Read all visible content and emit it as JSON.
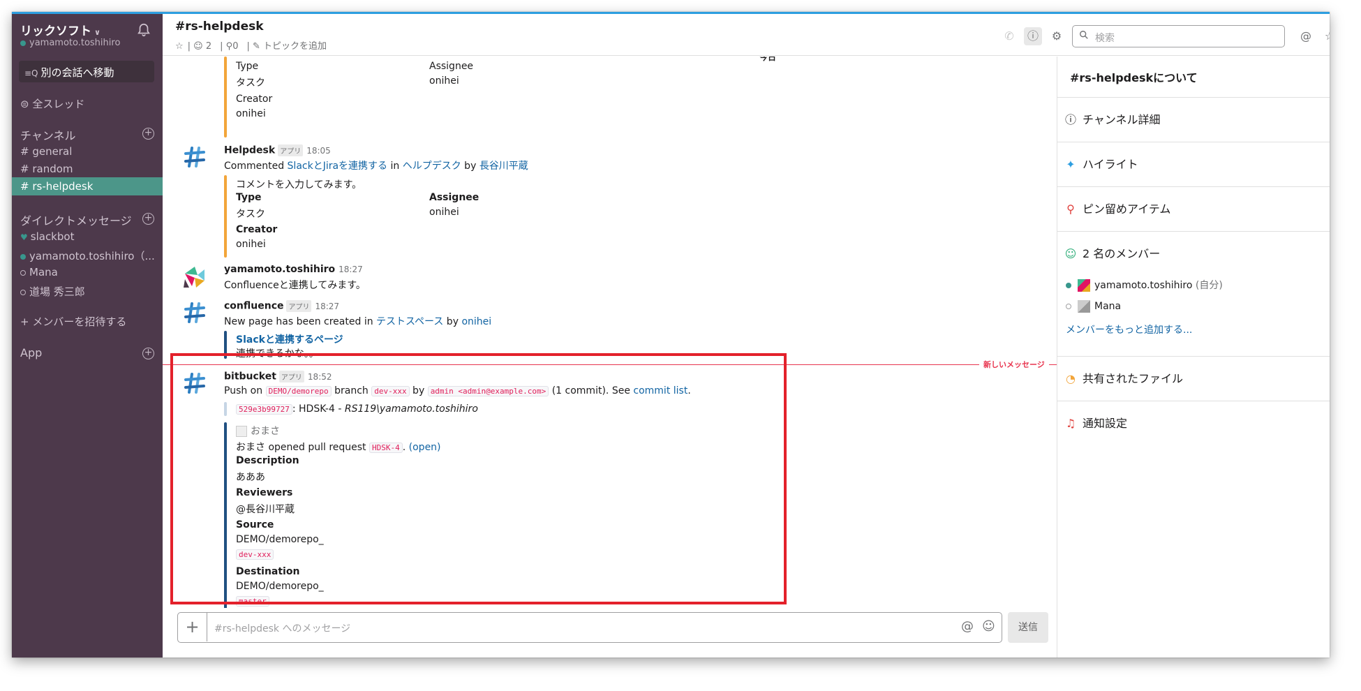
{
  "sidebar": {
    "team_name": "リックソフト",
    "user": "yamamoto.toshihiro",
    "jump_label": "別の会話へ移動",
    "threads_label": "全スレッド",
    "channels_header": "チャンネル",
    "channels": [
      "general",
      "random",
      "rs-helpdesk"
    ],
    "active_channel": "rs-helpdesk",
    "dm_header": "ダイレクトメッセージ",
    "dms": [
      "slackbot",
      "yamamoto.toshihiro（...",
      "Mana",
      "道場 秀三郎"
    ],
    "invite_label": "メンバーを招待する",
    "apps_label": "App"
  },
  "header": {
    "channel_title": "#rs-helpdesk",
    "members_count": "2",
    "pins_count": "0",
    "add_topic": "トピックを追加",
    "search_placeholder": "検索"
  },
  "messages": {
    "day_divider": "今日",
    "new_messages_label": "新しいメッセージ",
    "app_badge": "アプリ",
    "m0": {
      "type_label": "Type",
      "type_value": "タスク",
      "assignee_label": "Assignee",
      "assignee_value": "onihei",
      "creator_label": "Creator",
      "creator_value": "onihei"
    },
    "m1": {
      "author": "Helpdesk",
      "time": "18:05",
      "text_prefix": "Commented ",
      "link1": "SlackとJiraを連携する",
      "in_word": " in ",
      "link2": "ヘルプデスク",
      "by_word": " by ",
      "link3": "長谷川平蔵",
      "comment": "コメントを入力してみます。",
      "type_label": "Type",
      "type_value": "タスク",
      "assignee_label": "Assignee",
      "assignee_value": "onihei",
      "creator_label": "Creator",
      "creator_value": "onihei"
    },
    "m2": {
      "author": "yamamoto.toshihiro",
      "time": "18:27",
      "text": "Confluenceと連携してみます。"
    },
    "m3": {
      "author": "confluence",
      "time": "18:27",
      "text_prefix": "New page has been created  in ",
      "link1": "テストスペース",
      "by_word": " by ",
      "link2": "onihei",
      "att_title": "Slackと連携するページ",
      "att_text": "連携できるかな。。"
    },
    "m4": {
      "author": "bitbucket",
      "time": "18:52",
      "push_on": "Push on ",
      "repo_code": "DEMO/demorepo",
      "branch_word": " branch ",
      "branch_code": "dev-xxx",
      "by_word": " by ",
      "author_code": "admin <admin@example.com>",
      "commits": " (1 commit). See ",
      "commit_link": "commit list",
      "period": ".",
      "commit_hash": "529e3b99727",
      "commit_msg": ": HDSK-4 - ",
      "commit_path": "RS119\\yamamoto.toshihiro",
      "pr_user": "おまさ",
      "pr_text": "おまさ opened pull request ",
      "pr_code": "HDSK-4",
      "pr_sep": ". ",
      "pr_open": "(open)",
      "desc_label": "Description",
      "desc_value": "あああ",
      "rev_label": "Reviewers",
      "rev_value": "@長谷川平蔵",
      "src_label": "Source",
      "src_repo": "DEMO/demorepo_",
      "src_branch": "dev-xxx",
      "dst_label": "Destination",
      "dst_repo": "DEMO/demorepo_",
      "dst_branch": "master"
    }
  },
  "composer": {
    "placeholder": "#rs-helpdesk へのメッセージ",
    "send_label": "送信"
  },
  "right_panel": {
    "title": "#rs-helpdeskについて",
    "channel_details": "チャンネル詳細",
    "highlights": "ハイライト",
    "pinned": "ピン留めアイテム",
    "members_header": "2 名のメンバー",
    "member1": "yamamoto.toshihiro",
    "member1_self": "(自分)",
    "member2": "Mana",
    "add_members": "メンバーをもっと追加する...",
    "shared_files": "共有されたファイル",
    "notifications": "通知設定"
  },
  "colors": {
    "sidebar_bg": "#4d394b",
    "active_channel": "#4c9689",
    "link": "#1264a3",
    "highlight_box": "#e3212b",
    "new_messages": "#e8344e"
  }
}
